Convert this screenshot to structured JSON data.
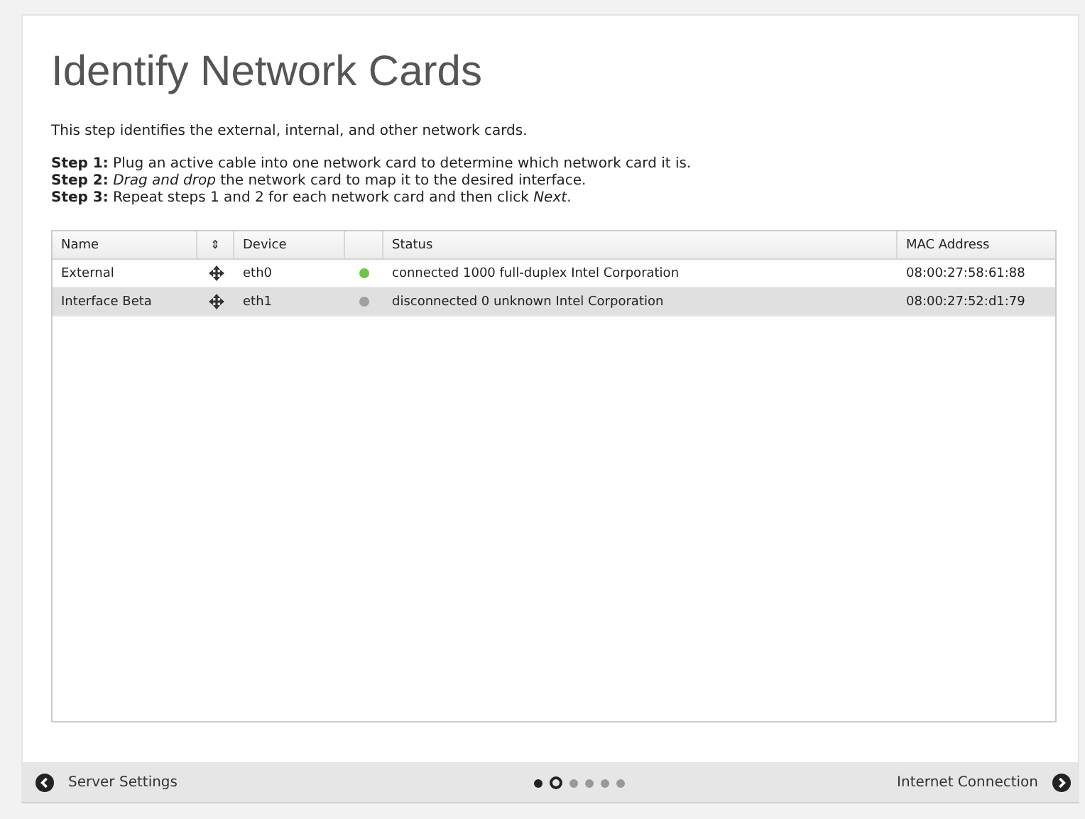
{
  "title": "Identify Network Cards",
  "intro": "This step identifies the external, internal, and other network cards.",
  "steps": [
    "**Step 1:** Plug an active cable into one network card to determine which network card it is.",
    "**Step 2:** *Drag and drop* the network card to map it to the desired interface.",
    "**Step 3:** Repeat steps 1 and 2 for each network card and then click *Next*."
  ],
  "table": {
    "columns": [
      "Name",
      "⇕",
      "Device",
      "",
      "Status",
      "MAC Address"
    ],
    "rows": [
      {
        "name": "External",
        "device": "eth0",
        "connected": true,
        "status": "connected 1000 full-duplex Intel Corporation",
        "mac": "08:00:27:58:61:88",
        "selected": false
      },
      {
        "name": "Interface Beta",
        "device": "eth1",
        "connected": false,
        "status": "disconnected 0 unknown Intel Corporation",
        "mac": "08:00:27:52:d1:79",
        "selected": true
      }
    ]
  },
  "footer": {
    "back": "Server Settings",
    "next": "Internet Connection",
    "pages": [
      {
        "kind": "done"
      },
      {
        "kind": "current"
      },
      {
        "kind": "pending"
      },
      {
        "kind": "pending"
      },
      {
        "kind": "pending"
      },
      {
        "kind": "pending"
      }
    ]
  }
}
